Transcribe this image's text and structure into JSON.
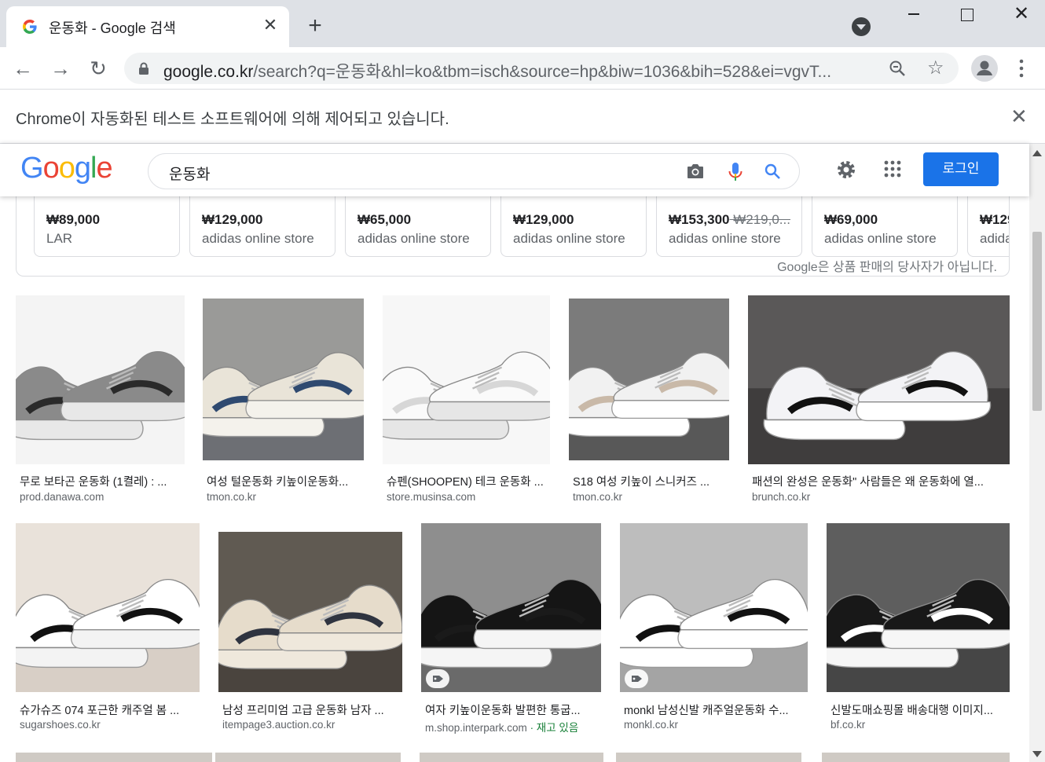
{
  "browser": {
    "tab_title": "운동화 - Google 검색",
    "url_host": "google.co.kr",
    "url_rest": "/search?q=운동화&hl=ko&tbm=isch&source=hp&biw=1036&bih=528&ei=vgvT...",
    "infobar_text": "Chrome이 자동화된 테스트 소프트웨어에 의해 제어되고 있습니다."
  },
  "google": {
    "logo": "Google",
    "query": "운동화",
    "login_label": "로그인"
  },
  "shopping": {
    "products": [
      {
        "price": "₩89,000",
        "old_price": "",
        "store": "LAR"
      },
      {
        "price": "₩129,000",
        "old_price": "",
        "store": "adidas online store"
      },
      {
        "price": "₩65,000",
        "old_price": "",
        "store": "adidas online store"
      },
      {
        "price": "₩129,000",
        "old_price": "",
        "store": "adidas online store"
      },
      {
        "price": "₩153,300",
        "old_price": "₩219,0...",
        "store": "adidas online store"
      },
      {
        "price": "₩69,000",
        "old_price": "",
        "store": "adidas online store"
      },
      {
        "price": "₩129",
        "old_price": "",
        "store": "adida"
      }
    ],
    "disclaimer": "Google은 상품 판매의 당사자가 아닙니다."
  },
  "results": [
    {
      "title": "무로 보타곤 운동화 (1켤레) : ...",
      "source": "prod.danawa.com",
      "stock": ""
    },
    {
      "title": "여성 털운동화 키높이운동화...",
      "source": "tmon.co.kr",
      "stock": ""
    },
    {
      "title": "슈펜(SHOOPEN) 테크 운동화 ...",
      "source": "store.musinsa.com",
      "stock": ""
    },
    {
      "title": "S18 여성 키높이 스니커즈 ...",
      "source": "tmon.co.kr",
      "stock": ""
    },
    {
      "title": "패션의 완성은 운동화\" 사람들은 왜 운동화에 열...",
      "source": "brunch.co.kr",
      "stock": ""
    },
    {
      "title": "슈가슈즈 074 포근한 캐주얼 봄 ...",
      "source": "sugarshoes.co.kr",
      "stock": ""
    },
    {
      "title": "남성 프리미엄 고급 운동화 남자 ...",
      "source": "itempage3.auction.co.kr",
      "stock": ""
    },
    {
      "title": "여자 키높이운동화 발편한 통굽...",
      "source": "m.shop.interpark.com",
      "stock": " · 재고 있음"
    },
    {
      "title": "monkl 남성신발 캐주얼운동화 수...",
      "source": "monkl.co.kr",
      "stock": ""
    },
    {
      "title": "신발도매쇼핑몰 배송대행 이미지...",
      "source": "bf.co.kr",
      "stock": ""
    }
  ],
  "colors": {
    "accent": "#1a73e8",
    "google_blue": "#4285f4",
    "google_red": "#ea4335",
    "google_yellow": "#fbbc05",
    "google_green": "#34a853"
  }
}
